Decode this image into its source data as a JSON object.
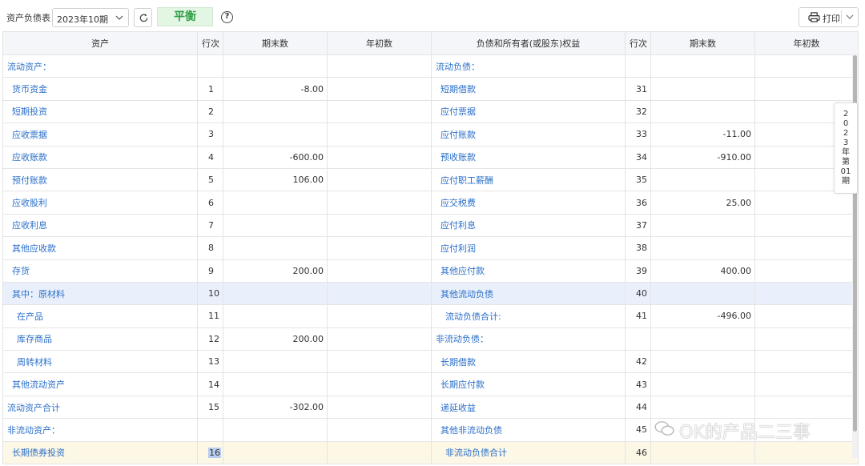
{
  "toolbar": {
    "report_label": "资产负债表",
    "period_value": "2023年10期",
    "balance_status": "平衡",
    "help_glyph": "?",
    "print_label": "打印"
  },
  "table": {
    "headers": [
      "资产",
      "行次",
      "期末数",
      "年初数",
      "负债和所有者(或股东)权益",
      "行次",
      "期末数",
      "年初数"
    ],
    "rows": [
      {
        "a_name": "流动资产：",
        "a_line": "",
        "a_end": "",
        "a_begin": "",
        "l_name": "流动负债：",
        "l_line": "",
        "l_end": "",
        "l_begin": ""
      },
      {
        "a_name": "货币资金",
        "a_line": "1",
        "a_end": "-8.00",
        "a_begin": "",
        "l_name": "短期借款",
        "l_line": "31",
        "l_end": "",
        "l_begin": ""
      },
      {
        "a_name": "短期投资",
        "a_line": "2",
        "a_end": "",
        "a_begin": "",
        "l_name": "应付票据",
        "l_line": "32",
        "l_end": "",
        "l_begin": ""
      },
      {
        "a_name": "应收票据",
        "a_line": "3",
        "a_end": "",
        "a_begin": "",
        "l_name": "应付账款",
        "l_line": "33",
        "l_end": "-11.00",
        "l_begin": ""
      },
      {
        "a_name": "应收账款",
        "a_line": "4",
        "a_end": "-600.00",
        "a_begin": "",
        "l_name": "预收账款",
        "l_line": "34",
        "l_end": "-910.00",
        "l_begin": ""
      },
      {
        "a_name": "预付账款",
        "a_line": "5",
        "a_end": "106.00",
        "a_begin": "",
        "l_name": "应付职工薪酬",
        "l_line": "35",
        "l_end": "",
        "l_begin": ""
      },
      {
        "a_name": "应收股利",
        "a_line": "6",
        "a_end": "",
        "a_begin": "",
        "l_name": "应交税费",
        "l_line": "36",
        "l_end": "25.00",
        "l_begin": ""
      },
      {
        "a_name": "应收利息",
        "a_line": "7",
        "a_end": "",
        "a_begin": "",
        "l_name": "应付利息",
        "l_line": "37",
        "l_end": "",
        "l_begin": ""
      },
      {
        "a_name": "其他应收款",
        "a_line": "8",
        "a_end": "",
        "a_begin": "",
        "l_name": "应付利润",
        "l_line": "38",
        "l_end": "",
        "l_begin": ""
      },
      {
        "a_name": "存货",
        "a_line": "9",
        "a_end": "200.00",
        "a_begin": "",
        "l_name": "其他应付款",
        "l_line": "39",
        "l_end": "400.00",
        "l_begin": ""
      },
      {
        "a_name": "其中：原材料",
        "a_line": "10",
        "a_end": "",
        "a_begin": "",
        "l_name": "其他流动负债",
        "l_line": "40",
        "l_end": "",
        "l_begin": ""
      },
      {
        "a_name": "在产品",
        "a_line": "11",
        "a_end": "",
        "a_begin": "",
        "l_name": "流动负债合计:",
        "l_line": "41",
        "l_end": "-496.00",
        "l_begin": ""
      },
      {
        "a_name": "库存商品",
        "a_line": "12",
        "a_end": "200.00",
        "a_begin": "",
        "l_name": "非流动负债：",
        "l_line": "",
        "l_end": "",
        "l_begin": ""
      },
      {
        "a_name": "周转材料",
        "a_line": "13",
        "a_end": "",
        "a_begin": "",
        "l_name": "长期借款",
        "l_line": "42",
        "l_end": "",
        "l_begin": ""
      },
      {
        "a_name": "其他流动资产",
        "a_line": "14",
        "a_end": "",
        "a_begin": "",
        "l_name": "长期应付款",
        "l_line": "43",
        "l_end": "",
        "l_begin": ""
      },
      {
        "a_name": "流动资产合计",
        "a_line": "15",
        "a_end": "-302.00",
        "a_begin": "",
        "l_name": "递延收益",
        "l_line": "44",
        "l_end": "",
        "l_begin": ""
      },
      {
        "a_name": "非流动资产：",
        "a_line": "",
        "a_end": "",
        "a_begin": "",
        "l_name": "其他非流动负债",
        "l_line": "45",
        "l_end": "",
        "l_begin": ""
      },
      {
        "a_name": "长期债券投资",
        "a_line": "16",
        "a_end": "",
        "a_begin": "",
        "l_name": "非流动负债合计",
        "l_line": "46",
        "l_end": "",
        "l_begin": ""
      }
    ]
  },
  "side_tab": {
    "chars": [
      "2",
      "0",
      "2",
      "3",
      "年",
      "第",
      "01",
      "期"
    ]
  },
  "watermark": {
    "text": "OK的产品二三事"
  },
  "colors": {
    "link_text": "#2a6fc9",
    "balance_green": "#2f9e44",
    "row_highlight": "#eaf0fb",
    "row_highlight_alt": "#fdf7e6"
  }
}
